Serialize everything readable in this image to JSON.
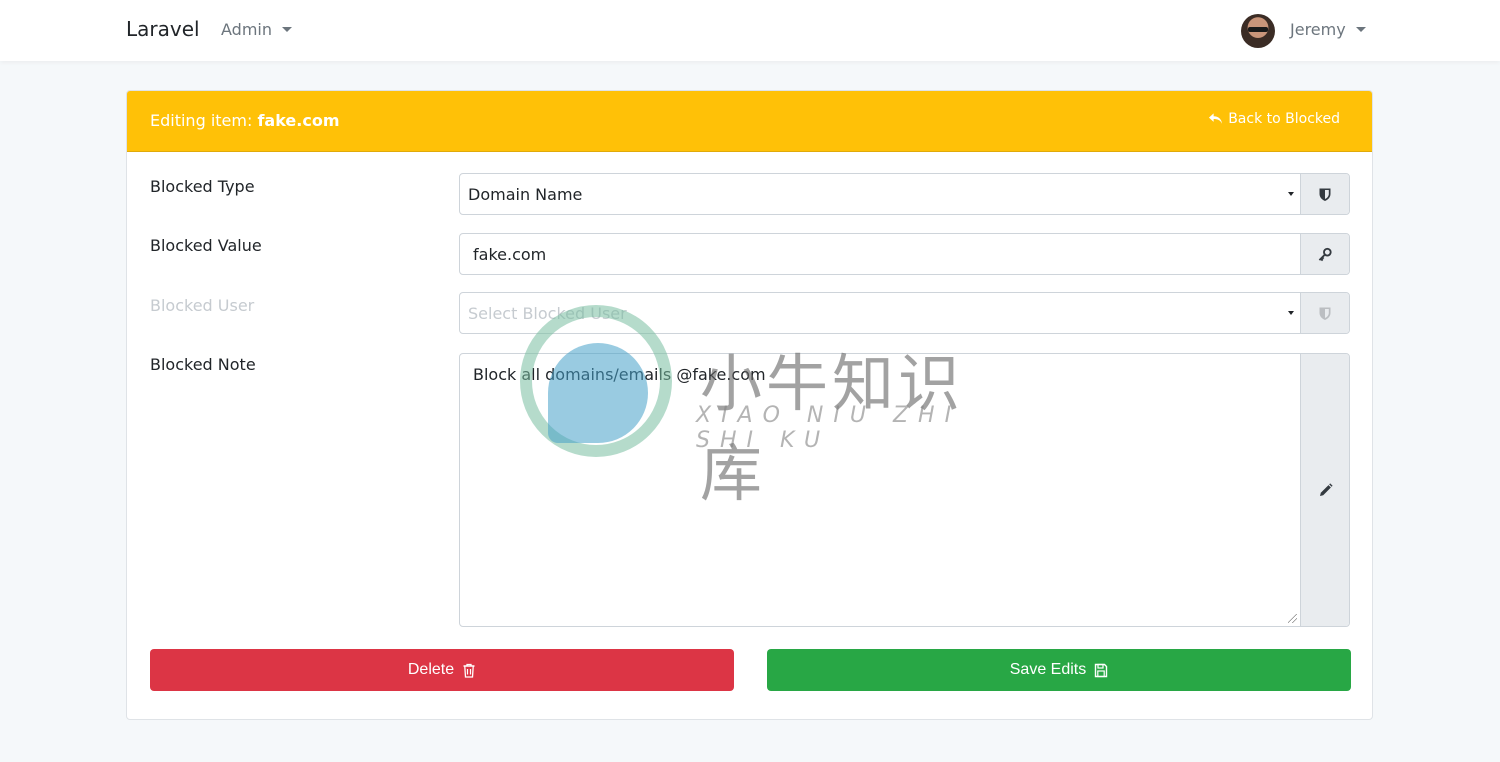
{
  "navbar": {
    "brand": "Laravel",
    "admin_menu": "Admin",
    "user_name": "Jeremy"
  },
  "card": {
    "title_prefix": "Editing item:",
    "title_item": "fake.com",
    "back_link": "Back to Blocked",
    "header_color": "#ffc107"
  },
  "form": {
    "blocked_type": {
      "label": "Blocked Type",
      "value": "Domain Name",
      "icon": "shield-icon"
    },
    "blocked_value": {
      "label": "Blocked Value",
      "value": "fake.com",
      "icon": "key-icon"
    },
    "blocked_user": {
      "label": "Blocked User",
      "placeholder": "Select Blocked User",
      "icon": "shield-icon"
    },
    "blocked_note": {
      "label": "Blocked Note",
      "value": "Block all domains/emails @fake.com",
      "icon": "pencil-icon"
    }
  },
  "buttons": {
    "delete": "Delete",
    "delete_color": "#dc3545",
    "save": "Save Edits",
    "save_color": "#28a745"
  },
  "watermark": {
    "cn": "小牛知识库",
    "en": "XIAO NIU ZHI SHI KU"
  }
}
